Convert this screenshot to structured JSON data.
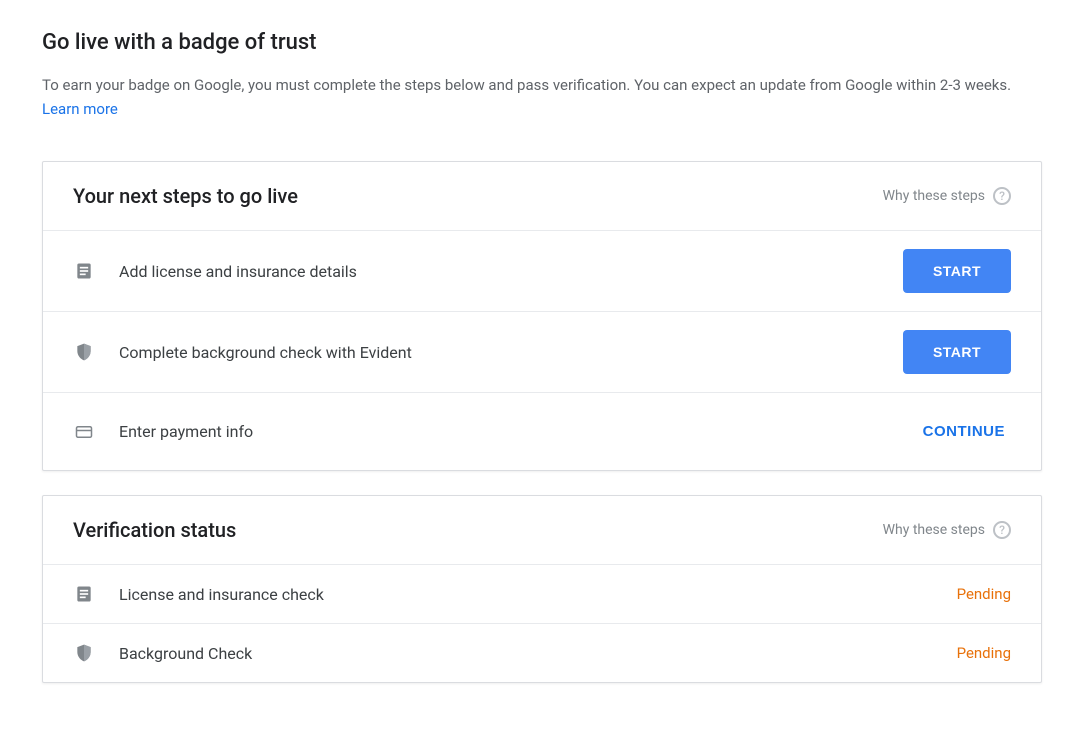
{
  "header": {
    "title": "Go live with a badge of trust",
    "description": "To earn your badge on Google, you must complete the steps below and pass verification. You can expect an update from Google within 2-3 weeks. ",
    "learn_more": "Learn more"
  },
  "steps_card": {
    "title": "Your next steps to go live",
    "why_link": "Why these steps",
    "items": [
      {
        "label": "Add license and insurance details",
        "action": "START",
        "action_style": "primary",
        "icon": "document"
      },
      {
        "label": "Complete background check with Evident",
        "action": "START",
        "action_style": "primary",
        "icon": "shield"
      },
      {
        "label": "Enter payment info",
        "action": "CONTINUE",
        "action_style": "text",
        "icon": "card"
      }
    ]
  },
  "status_card": {
    "title": "Verification status",
    "why_link": "Why these steps",
    "items": [
      {
        "label": "License and insurance check",
        "status": "Pending",
        "icon": "document"
      },
      {
        "label": "Background Check",
        "status": "Pending",
        "icon": "shield"
      }
    ]
  }
}
